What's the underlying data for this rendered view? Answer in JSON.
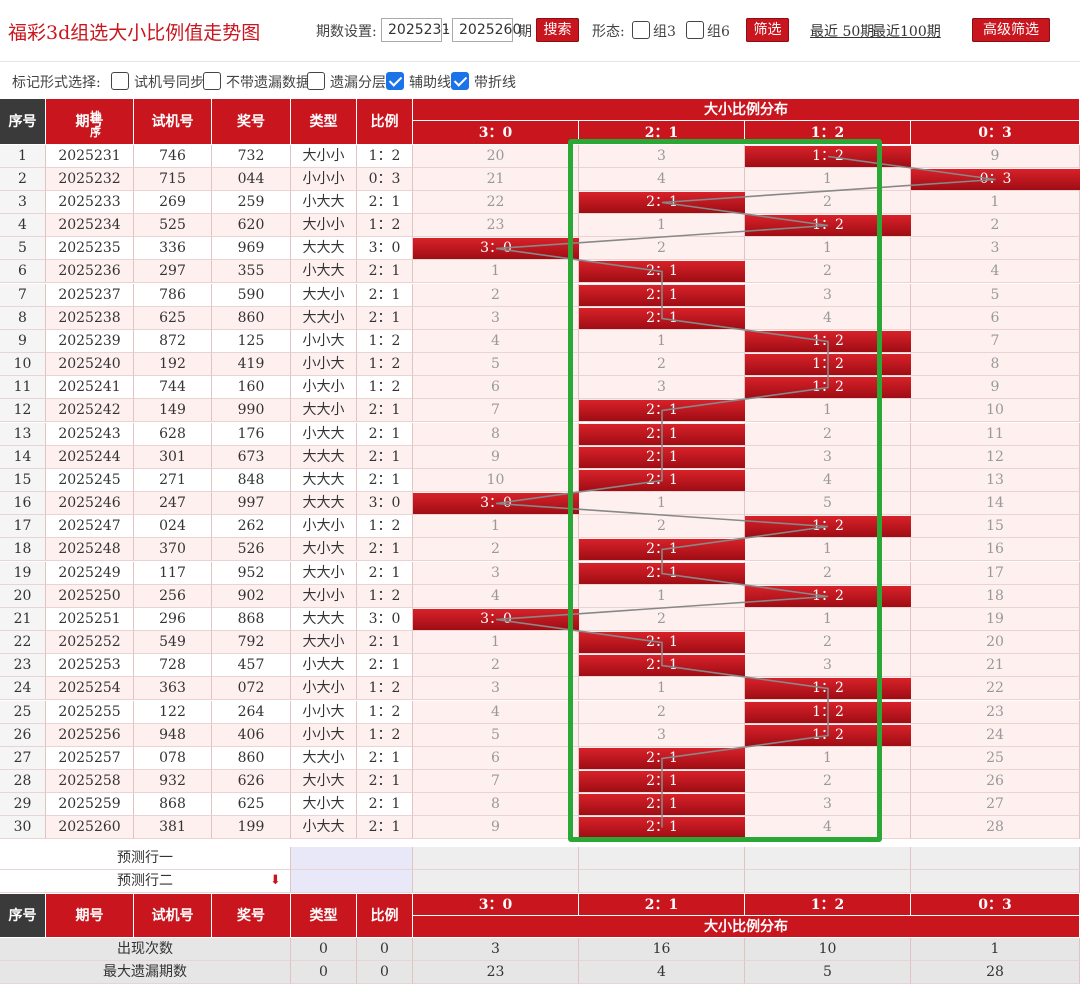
{
  "header": {
    "title": "福彩3d组选大小比例值走势图",
    "period_label": "期数设置:",
    "period_from": "2025231",
    "dash": "-",
    "period_to": "2025260",
    "period_unit": "期",
    "search_label": "搜索",
    "form_label": "形态:",
    "zu3_label": "组3",
    "zu6_label": "组6",
    "filter_label": "筛选",
    "recent50": "最近 50期",
    "recent100": "最近100期",
    "advanced_label": "高级筛选"
  },
  "options": {
    "mark_label": "标记形式选择:",
    "items": [
      {
        "label": "试机号同步",
        "checked": false
      },
      {
        "label": "不带遗漏数据",
        "checked": false
      },
      {
        "label": "遗漏分层",
        "checked": false
      },
      {
        "label": "辅助线",
        "checked": true
      },
      {
        "label": "带折线",
        "checked": true
      }
    ]
  },
  "table": {
    "headers": {
      "seq": "序号",
      "issue": "期号",
      "sort": "排序",
      "test": "试机号",
      "prize": "奖号",
      "type": "类型",
      "ratio": "比例",
      "group": "大小比例分布"
    },
    "dist_cols": [
      "3：0",
      "2：1",
      "1：2",
      "0：3"
    ],
    "rows": [
      {
        "seq": "1",
        "issue": "2025231",
        "test": "746",
        "prize": "732",
        "type": "大小小",
        "ratio": "1：2",
        "hit": 2,
        "miss": [
          "20",
          "3",
          "",
          "9"
        ]
      },
      {
        "seq": "2",
        "issue": "2025232",
        "test": "715",
        "prize": "044",
        "type": "小小小",
        "ratio": "0：3",
        "hit": 3,
        "miss": [
          "21",
          "4",
          "1",
          ""
        ]
      },
      {
        "seq": "3",
        "issue": "2025233",
        "test": "269",
        "prize": "259",
        "type": "小大大",
        "ratio": "2：1",
        "hit": 1,
        "miss": [
          "22",
          "",
          "2",
          "1"
        ]
      },
      {
        "seq": "4",
        "issue": "2025234",
        "test": "525",
        "prize": "620",
        "type": "大小小",
        "ratio": "1：2",
        "hit": 2,
        "miss": [
          "23",
          "1",
          "",
          "2"
        ]
      },
      {
        "seq": "5",
        "issue": "2025235",
        "test": "336",
        "prize": "969",
        "type": "大大大",
        "ratio": "3：0",
        "hit": 0,
        "miss": [
          "",
          "2",
          "1",
          "3"
        ]
      },
      {
        "seq": "6",
        "issue": "2025236",
        "test": "297",
        "prize": "355",
        "type": "小大大",
        "ratio": "2：1",
        "hit": 1,
        "miss": [
          "1",
          "",
          "2",
          "4"
        ]
      },
      {
        "seq": "7",
        "issue": "2025237",
        "test": "786",
        "prize": "590",
        "type": "大大小",
        "ratio": "2：1",
        "hit": 1,
        "miss": [
          "2",
          "",
          "3",
          "5"
        ]
      },
      {
        "seq": "8",
        "issue": "2025238",
        "test": "625",
        "prize": "860",
        "type": "大大小",
        "ratio": "2：1",
        "hit": 1,
        "miss": [
          "3",
          "",
          "4",
          "6"
        ]
      },
      {
        "seq": "9",
        "issue": "2025239",
        "test": "872",
        "prize": "125",
        "type": "小小大",
        "ratio": "1：2",
        "hit": 2,
        "miss": [
          "4",
          "1",
          "",
          "7"
        ]
      },
      {
        "seq": "10",
        "issue": "2025240",
        "test": "192",
        "prize": "419",
        "type": "小小大",
        "ratio": "1：2",
        "hit": 2,
        "miss": [
          "5",
          "2",
          "",
          "8"
        ]
      },
      {
        "seq": "11",
        "issue": "2025241",
        "test": "744",
        "prize": "160",
        "type": "小大小",
        "ratio": "1：2",
        "hit": 2,
        "miss": [
          "6",
          "3",
          "",
          "9"
        ]
      },
      {
        "seq": "12",
        "issue": "2025242",
        "test": "149",
        "prize": "990",
        "type": "大大小",
        "ratio": "2：1",
        "hit": 1,
        "miss": [
          "7",
          "",
          "1",
          "10"
        ]
      },
      {
        "seq": "13",
        "issue": "2025243",
        "test": "628",
        "prize": "176",
        "type": "小大大",
        "ratio": "2：1",
        "hit": 1,
        "miss": [
          "8",
          "",
          "2",
          "11"
        ]
      },
      {
        "seq": "14",
        "issue": "2025244",
        "test": "301",
        "prize": "673",
        "type": "大大大",
        "ratio": "2：1",
        "hit": 1,
        "miss": [
          "9",
          "",
          "3",
          "12"
        ]
      },
      {
        "seq": "15",
        "issue": "2025245",
        "test": "271",
        "prize": "848",
        "type": "大大大",
        "ratio": "2：1",
        "hit": 1,
        "miss": [
          "10",
          "",
          "4",
          "13"
        ]
      },
      {
        "seq": "16",
        "issue": "2025246",
        "test": "247",
        "prize": "997",
        "type": "大大大",
        "ratio": "3：0",
        "hit": 0,
        "miss": [
          "",
          "1",
          "5",
          "14"
        ]
      },
      {
        "seq": "17",
        "issue": "2025247",
        "test": "024",
        "prize": "262",
        "type": "小大小",
        "ratio": "1：2",
        "hit": 2,
        "miss": [
          "1",
          "2",
          "",
          "15"
        ]
      },
      {
        "seq": "18",
        "issue": "2025248",
        "test": "370",
        "prize": "526",
        "type": "大小大",
        "ratio": "2：1",
        "hit": 1,
        "miss": [
          "2",
          "",
          "1",
          "16"
        ]
      },
      {
        "seq": "19",
        "issue": "2025249",
        "test": "117",
        "prize": "952",
        "type": "大大小",
        "ratio": "2：1",
        "hit": 1,
        "miss": [
          "3",
          "",
          "2",
          "17"
        ]
      },
      {
        "seq": "20",
        "issue": "2025250",
        "test": "256",
        "prize": "902",
        "type": "大小小",
        "ratio": "1：2",
        "hit": 2,
        "miss": [
          "4",
          "1",
          "",
          "18"
        ]
      },
      {
        "seq": "21",
        "issue": "2025251",
        "test": "296",
        "prize": "868",
        "type": "大大大",
        "ratio": "3：0",
        "hit": 0,
        "miss": [
          "",
          "2",
          "1",
          "19"
        ]
      },
      {
        "seq": "22",
        "issue": "2025252",
        "test": "549",
        "prize": "792",
        "type": "大大小",
        "ratio": "2：1",
        "hit": 1,
        "miss": [
          "1",
          "",
          "2",
          "20"
        ]
      },
      {
        "seq": "23",
        "issue": "2025253",
        "test": "728",
        "prize": "457",
        "type": "小大大",
        "ratio": "2：1",
        "hit": 1,
        "miss": [
          "2",
          "",
          "3",
          "21"
        ]
      },
      {
        "seq": "24",
        "issue": "2025254",
        "test": "363",
        "prize": "072",
        "type": "小大小",
        "ratio": "1：2",
        "hit": 2,
        "miss": [
          "3",
          "1",
          "",
          "22"
        ]
      },
      {
        "seq": "25",
        "issue": "2025255",
        "test": "122",
        "prize": "264",
        "type": "小小大",
        "ratio": "1：2",
        "hit": 2,
        "miss": [
          "4",
          "2",
          "",
          "23"
        ]
      },
      {
        "seq": "26",
        "issue": "2025256",
        "test": "948",
        "prize": "406",
        "type": "小小大",
        "ratio": "1：2",
        "hit": 2,
        "miss": [
          "5",
          "3",
          "",
          "24"
        ]
      },
      {
        "seq": "27",
        "issue": "2025257",
        "test": "078",
        "prize": "860",
        "type": "大大小",
        "ratio": "2：1",
        "hit": 1,
        "miss": [
          "6",
          "",
          "1",
          "25"
        ]
      },
      {
        "seq": "28",
        "issue": "2025258",
        "test": "932",
        "prize": "626",
        "type": "大小大",
        "ratio": "2：1",
        "hit": 1,
        "miss": [
          "7",
          "",
          "2",
          "26"
        ]
      },
      {
        "seq": "29",
        "issue": "2025259",
        "test": "868",
        "prize": "625",
        "type": "大小大",
        "ratio": "2：1",
        "hit": 1,
        "miss": [
          "8",
          "",
          "3",
          "27"
        ]
      },
      {
        "seq": "30",
        "issue": "2025260",
        "test": "381",
        "prize": "199",
        "type": "小大大",
        "ratio": "2：1",
        "hit": 1,
        "miss": [
          "9",
          "",
          "4",
          "28"
        ]
      }
    ],
    "predict": [
      "预测行一",
      "预测行二"
    ],
    "stats": [
      {
        "label": "出现次数",
        "type": "0",
        "ratio": "0",
        "vals": [
          "3",
          "16",
          "10",
          "1"
        ]
      },
      {
        "label": "最大遗漏期数",
        "type": "0",
        "ratio": "0",
        "vals": [
          "23",
          "4",
          "5",
          "28"
        ]
      }
    ]
  },
  "colors": {
    "accent": "#c9151e",
    "highlight_box": "#2aa836"
  }
}
